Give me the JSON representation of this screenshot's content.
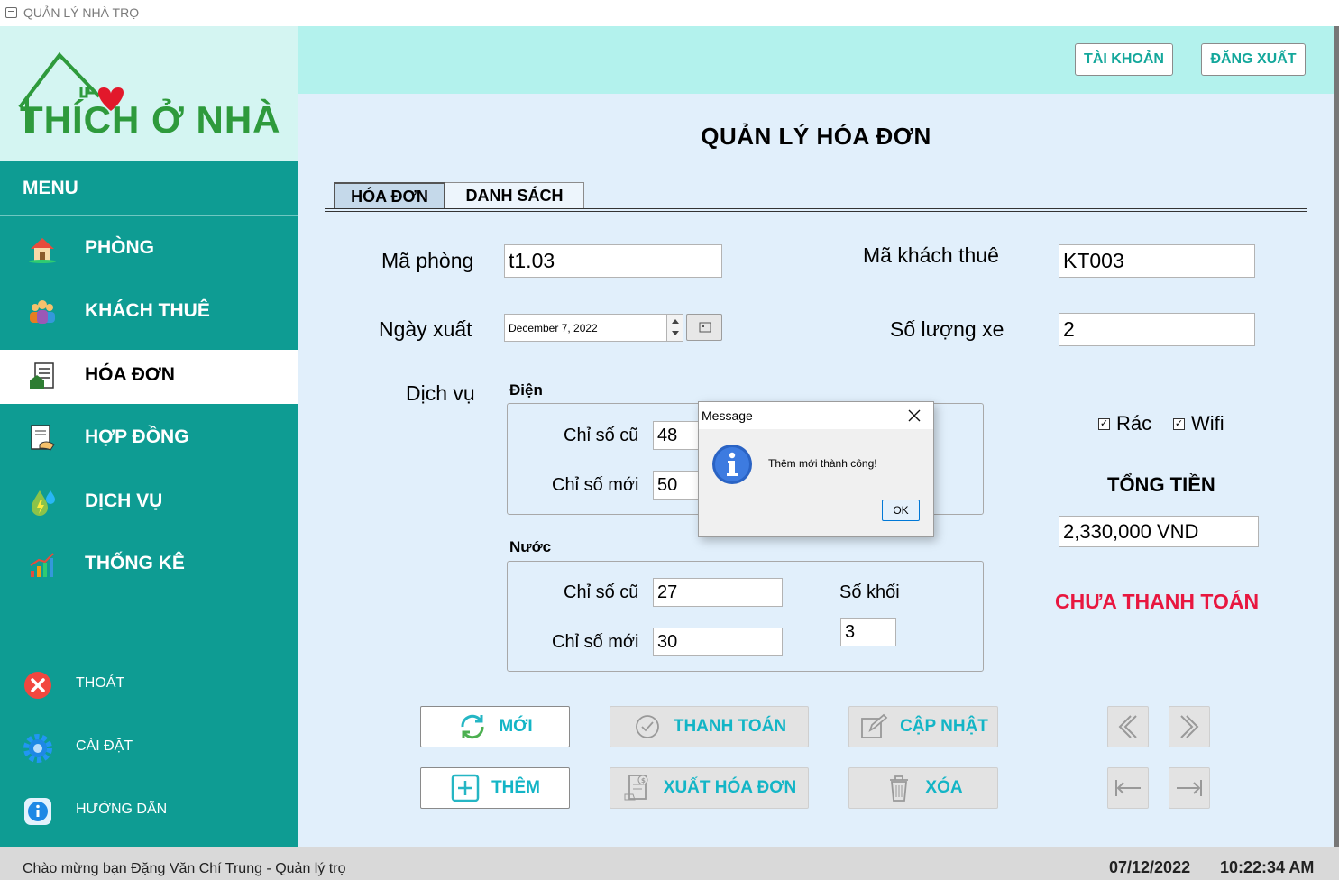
{
  "window": {
    "title": "QUẢN LÝ NHÀ TRỌ"
  },
  "logo": {
    "text": "THÍCH Ở NHÀ"
  },
  "sidebar": {
    "menu_label": "MENU",
    "items": [
      {
        "label": "PHÒNG",
        "icon": "house-icon"
      },
      {
        "label": "KHÁCH THUÊ",
        "icon": "people-icon"
      },
      {
        "label": "HÓA ĐƠN",
        "icon": "invoice-icon"
      },
      {
        "label": "HỢP ĐỒNG",
        "icon": "contract-icon"
      },
      {
        "label": "DỊCH VỤ",
        "icon": "utilities-icon"
      },
      {
        "label": "THỐNG KÊ",
        "icon": "stats-chart-icon"
      }
    ],
    "utility": [
      {
        "label": "THOÁT",
        "icon": "exit-icon"
      },
      {
        "label": "CÀI ĐẶT",
        "icon": "gear-icon"
      },
      {
        "label": "HƯỚNG DẪN",
        "icon": "info-icon"
      }
    ]
  },
  "header": {
    "account_label": "TÀI KHOẢN",
    "logout_label": "ĐĂNG XUẤT"
  },
  "main": {
    "title": "QUẢN LÝ HÓA ĐƠN",
    "tabs": [
      {
        "label": "HÓA ĐƠN"
      },
      {
        "label": "DANH SÁCH"
      }
    ]
  },
  "form": {
    "room_label": "Mã phòng",
    "room_value": "t1.03",
    "tenant_label": "Mã khách thuê",
    "tenant_value": "KT003",
    "date_label": "Ngày xuất",
    "date_value": "December 7, 2022",
    "vehicle_label": "Số lượng xe",
    "vehicle_value": "2",
    "service_label": "Dịch vụ",
    "electric": {
      "group_label": "Điện",
      "old_label": "Chỉ số cũ",
      "old_value": "48",
      "new_label": "Chỉ số mới",
      "new_value": "50"
    },
    "water": {
      "group_label": "Nước",
      "old_label": "Chỉ số cũ",
      "old_value": "27",
      "new_label": "Chỉ số mới",
      "new_value": "30",
      "volume_label": "Số khối",
      "volume_value": "3"
    },
    "trash_label": "Rác",
    "trash_checked": true,
    "wifi_label": "Wifi",
    "wifi_checked": true,
    "total_label": "TỔNG TIỀN",
    "total_value": "2,330,000 VND",
    "payment_status": "CHƯA THANH TOÁN",
    "payment_status_color": "#e8173f"
  },
  "actions": {
    "new_label": "MỚI",
    "pay_label": "THANH TOÁN",
    "update_label": "CẬP NHẬT",
    "add_label": "THÊM",
    "export_label": "XUẤT HÓA ĐƠN",
    "delete_label": "XÓA"
  },
  "dialog": {
    "title": "Message",
    "message": "Thêm mới thành công!",
    "ok_label": "OK"
  },
  "status_bar": {
    "welcome": "Chào mừng bạn Đặng Văn Chí Trung - Quản lý trọ",
    "date": "07/12/2022",
    "time": "10:22:34 AM"
  },
  "colors": {
    "sidebar": "#0e9c93",
    "accent_text": "#13b5c6",
    "header_bg": "#b3f2ed",
    "main_bg": "#e1effb",
    "logo_green": "#2e9a3c"
  }
}
